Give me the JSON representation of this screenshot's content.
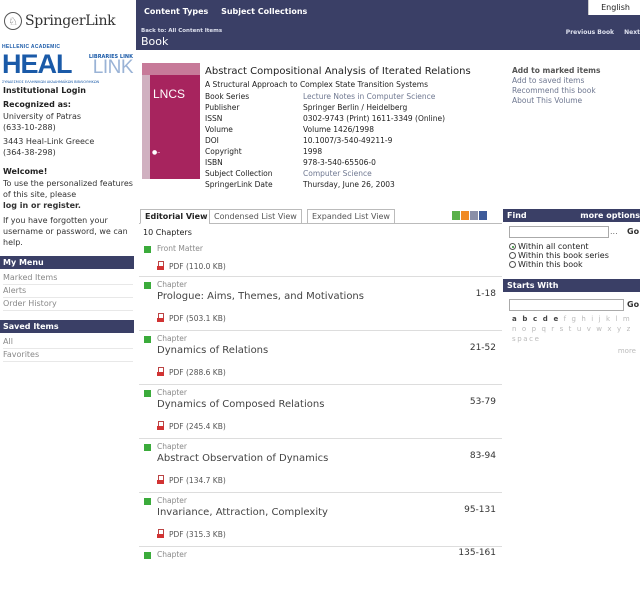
{
  "topbar": {
    "nav": [
      "Content Types",
      "Subject Collections"
    ],
    "language": "English",
    "back_label": "Back to:",
    "back_target": "All Content Items",
    "section_title": "Book",
    "previous": "Previous Book",
    "next": "Next"
  },
  "left": {
    "brand": "SpringerLink",
    "heal": {
      "top": "HELLENIC ACADEMIC",
      "big": "HEAL",
      "libraries": "LIBRARIES LINK",
      "link": "LINK",
      "tiny": "ΣΥΝΔΕΣΜΟΣ ΕΛΛΗΝΙΚΩΝ ΑΚΑΔΗΜΑΪΚΩΝ ΒΙΒΛΙΟΘΗΚΩΝ"
    },
    "institutional_login": "Institutional Login",
    "recognized_as": "Recognized as:",
    "inst1": "University of Patras",
    "inst1_id": "(633-10-288)",
    "inst2": "3443 Heal-Link Greece",
    "inst2_id": "(364-38-298)",
    "welcome": "Welcome!",
    "welcome_text": "To use the personalized features of this site, please",
    "login_link": "log in or register.",
    "forgot_text": "If you have forgotten your username or password, we can help.",
    "my_menu": "My Menu",
    "menu_items": [
      "Marked Items",
      "Alerts",
      "Order History"
    ],
    "saved_items": "Saved Items",
    "saved_list": [
      "All",
      "Favorites"
    ]
  },
  "book": {
    "cover_text": "LNCS",
    "title": "Abstract Compositional Analysis of Iterated Relations",
    "subtitle": "A Structural Approach to Complex State Transition Systems",
    "meta": [
      {
        "k": "Book Series",
        "v": "Lecture Notes in Computer Science",
        "link": true
      },
      {
        "k": "Publisher",
        "v": "Springer Berlin / Heidelberg",
        "link": false
      },
      {
        "k": "ISSN",
        "v": "0302-9743 (Print) 1611-3349 (Online)",
        "link": false
      },
      {
        "k": "Volume",
        "v": "Volume 1426/1998",
        "link": false
      },
      {
        "k": "DOI",
        "v": "10.1007/3-540-49211-9",
        "link": false
      },
      {
        "k": "Copyright",
        "v": "1998",
        "link": false
      },
      {
        "k": "ISBN",
        "v": "978-3-540-65506-0",
        "link": false
      },
      {
        "k": "Subject Collection",
        "v": "Computer Science",
        "link": true
      },
      {
        "k": "SpringerLink Date",
        "v": "Thursday, June 26, 2003",
        "link": false
      }
    ],
    "actions": [
      "Add to marked items",
      "Add to saved items",
      "Recommend this book",
      "About This Volume"
    ]
  },
  "tabs": [
    "Editorial View",
    "Condensed List View",
    "Expanded List View"
  ],
  "chapter_count": "10 Chapters",
  "front_matter": {
    "type": "Front Matter",
    "pdf": "PDF (110.0 KB)"
  },
  "chapters": [
    {
      "type": "Chapter",
      "title": "Prologue: Aims, Themes, and Motivations",
      "pages": "1-18",
      "pdf": "PDF (503.1 KB)"
    },
    {
      "type": "Chapter",
      "title": "Dynamics of Relations",
      "pages": "21-52",
      "pdf": "PDF (288.6 KB)"
    },
    {
      "type": "Chapter",
      "title": "Dynamics of Composed Relations",
      "pages": "53-79",
      "pdf": "PDF (245.4 KB)"
    },
    {
      "type": "Chapter",
      "title": "Abstract Observation of Dynamics",
      "pages": "83-94",
      "pdf": "PDF (134.7 KB)"
    },
    {
      "type": "Chapter",
      "title": "Invariance, Attraction, Complexity",
      "pages": "95-131",
      "pdf": "PDF (315.3 KB)"
    },
    {
      "type": "Chapter",
      "title": "",
      "pages": "135-161",
      "pdf": ""
    }
  ],
  "find": {
    "title": "Find",
    "more_options": "more options",
    "dots": "...",
    "go": "Go",
    "scope": [
      "Within all content",
      "Within this book series",
      "Within this book"
    ]
  },
  "starts": {
    "title": "Starts With",
    "go": "Go",
    "letters_active": "a b c d e",
    "letters_rest": " f g h i j k l m n o p q r s t u v w x y z",
    "space": "space",
    "more": "more"
  }
}
